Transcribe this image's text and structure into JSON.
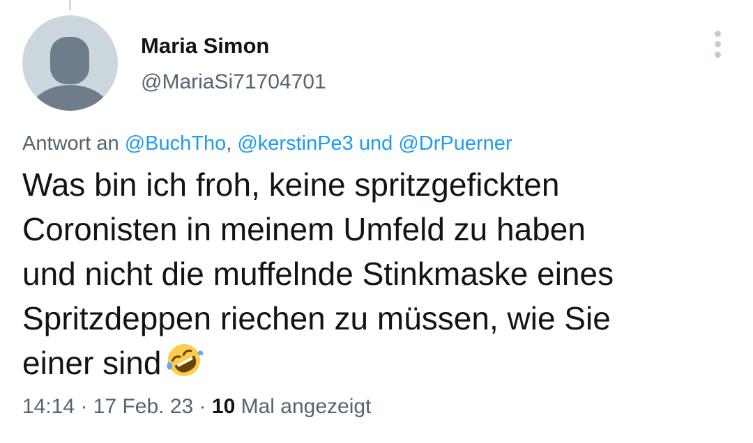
{
  "author": {
    "name": "Maria Simon",
    "handle": "@MariaSi71704701"
  },
  "reply": {
    "prefix": "Antwort an",
    "mentions": [
      "@BuchTho",
      "@kerstinPe3",
      "@DrPuerner"
    ],
    "separator": ",",
    "conjunction": "und"
  },
  "tweet": {
    "lines": [
      "Was bin ich froh, keine spritzgefickten",
      "Coronisten in meinem Umfeld zu haben",
      "und nicht die muffelnde Stinkmaske eines",
      "Spritzdeppen riechen zu müssen, wie Sie",
      "einer sind"
    ],
    "emoji": "rolling-on-floor-laughing-icon"
  },
  "meta": {
    "time": "14:14",
    "date": "17 Feb. 23",
    "dot": "·",
    "views_count": "10",
    "views_label": "Mal angezeigt"
  },
  "colors": {
    "accent": "#1d9bf0",
    "secondary_text": "#536471",
    "avatar_bg": "#ccd6dd",
    "avatar_figure": "#6e7d89"
  }
}
